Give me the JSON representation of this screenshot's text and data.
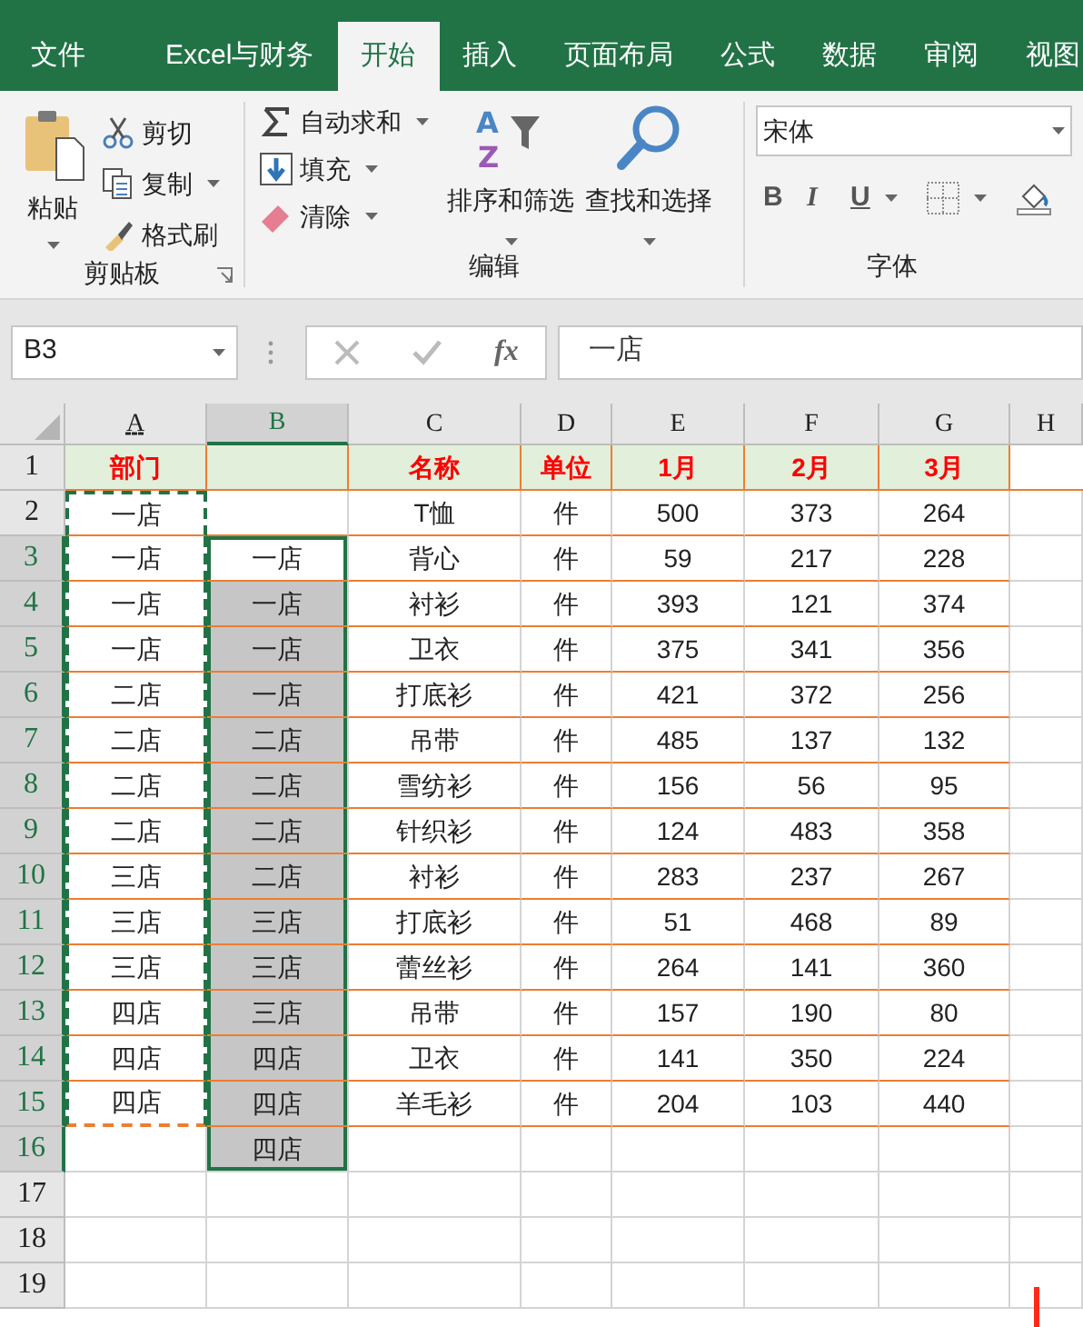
{
  "tabs": [
    {
      "label": "文件",
      "selected": false
    },
    {
      "label": "Excel与财务",
      "selected": false
    },
    {
      "label": "开始",
      "selected": true
    },
    {
      "label": "插入",
      "selected": false
    },
    {
      "label": "页面布局",
      "selected": false
    },
    {
      "label": "公式",
      "selected": false
    },
    {
      "label": "数据",
      "selected": false
    },
    {
      "label": "审阅",
      "selected": false
    },
    {
      "label": "视图",
      "selected": false
    }
  ],
  "ribbon": {
    "clipboard": {
      "label": "剪贴板",
      "paste": "粘贴",
      "cut": "剪切",
      "copy": "复制",
      "format_painter": "格式刷"
    },
    "editing": {
      "label": "编辑",
      "autosum": "自动求和",
      "fill": "填充",
      "clear": "清除",
      "sort_filter": "排序和筛选",
      "find_select": "查找和选择"
    },
    "font": {
      "label": "字体",
      "font_name": "宋体",
      "bold": "B",
      "italic": "I",
      "underline": "U"
    },
    "sort_icon_letters": {
      "top": "A",
      "bottom": "Z"
    }
  },
  "formula_bar": {
    "name_box": "B3",
    "function_label": "fx",
    "value": "一店"
  },
  "columns": [
    {
      "label": "A",
      "selected": false,
      "marquee": true
    },
    {
      "label": "B",
      "selected": true,
      "marquee": false
    },
    {
      "label": "C",
      "selected": false,
      "marquee": false
    },
    {
      "label": "D",
      "selected": false,
      "marquee": false
    },
    {
      "label": "E",
      "selected": false,
      "marquee": false
    },
    {
      "label": "F",
      "selected": false,
      "marquee": false
    },
    {
      "label": "G",
      "selected": false,
      "marquee": false
    },
    {
      "label": "H",
      "selected": false,
      "marquee": false
    }
  ],
  "rows": [
    {
      "number": "1",
      "kind": "header",
      "selected": false,
      "active": false,
      "marquee": false,
      "cells": [
        "部门",
        null,
        "名称",
        "单位",
        "1月",
        "2月",
        "3月",
        null
      ]
    },
    {
      "number": "2",
      "kind": "data",
      "selected": false,
      "active": false,
      "marquee": true,
      "cells": [
        "一店",
        null,
        "T恤",
        "件",
        "500",
        "373",
        "264",
        null
      ]
    },
    {
      "number": "3",
      "kind": "data",
      "selected": true,
      "active": true,
      "marquee": true,
      "cells": [
        "一店",
        "一店",
        "背心",
        "件",
        "59",
        "217",
        "228",
        null
      ]
    },
    {
      "number": "4",
      "kind": "data",
      "selected": true,
      "active": false,
      "marquee": true,
      "cells": [
        "一店",
        "一店",
        "衬衫",
        "件",
        "393",
        "121",
        "374",
        null
      ]
    },
    {
      "number": "5",
      "kind": "data",
      "selected": true,
      "active": false,
      "marquee": true,
      "cells": [
        "一店",
        "一店",
        "卫衣",
        "件",
        "375",
        "341",
        "356",
        null
      ]
    },
    {
      "number": "6",
      "kind": "data",
      "selected": true,
      "active": false,
      "marquee": true,
      "cells": [
        "二店",
        "一店",
        "打底衫",
        "件",
        "421",
        "372",
        "256",
        null
      ]
    },
    {
      "number": "7",
      "kind": "data",
      "selected": true,
      "active": false,
      "marquee": true,
      "cells": [
        "二店",
        "二店",
        "吊带",
        "件",
        "485",
        "137",
        "132",
        null
      ]
    },
    {
      "number": "8",
      "kind": "data",
      "selected": true,
      "active": false,
      "marquee": true,
      "cells": [
        "二店",
        "二店",
        "雪纺衫",
        "件",
        "156",
        "56",
        "95",
        null
      ]
    },
    {
      "number": "9",
      "kind": "data",
      "selected": true,
      "active": false,
      "marquee": true,
      "cells": [
        "二店",
        "二店",
        "针织衫",
        "件",
        "124",
        "483",
        "358",
        null
      ]
    },
    {
      "number": "10",
      "kind": "data",
      "selected": true,
      "active": false,
      "marquee": true,
      "cells": [
        "三店",
        "二店",
        "衬衫",
        "件",
        "283",
        "237",
        "267",
        null
      ]
    },
    {
      "number": "11",
      "kind": "data",
      "selected": true,
      "active": false,
      "marquee": true,
      "cells": [
        "三店",
        "三店",
        "打底衫",
        "件",
        "51",
        "468",
        "89",
        null
      ]
    },
    {
      "number": "12",
      "kind": "data",
      "selected": true,
      "active": false,
      "marquee": true,
      "cells": [
        "三店",
        "三店",
        "蕾丝衫",
        "件",
        "264",
        "141",
        "360",
        null
      ]
    },
    {
      "number": "13",
      "kind": "data",
      "selected": true,
      "active": false,
      "marquee": true,
      "cells": [
        "四店",
        "三店",
        "吊带",
        "件",
        "157",
        "190",
        "80",
        null
      ]
    },
    {
      "number": "14",
      "kind": "data",
      "selected": true,
      "active": false,
      "marquee": true,
      "cells": [
        "四店",
        "四店",
        "卫衣",
        "件",
        "141",
        "350",
        "224",
        null
      ]
    },
    {
      "number": "15",
      "kind": "data",
      "selected": true,
      "active": false,
      "marquee": true,
      "cells": [
        "四店",
        "四店",
        "羊毛衫",
        "件",
        "204",
        "103",
        "440",
        null
      ]
    },
    {
      "number": "16",
      "kind": "empty",
      "selected": true,
      "active": false,
      "marquee": false,
      "cells": [
        null,
        "四店",
        null,
        null,
        null,
        null,
        null,
        null
      ]
    },
    {
      "number": "17",
      "kind": "empty",
      "selected": false,
      "active": false,
      "marquee": false,
      "cells": [
        null,
        null,
        null,
        null,
        null,
        null,
        null,
        null
      ]
    },
    {
      "number": "18",
      "kind": "empty",
      "selected": false,
      "active": false,
      "marquee": false,
      "cells": [
        null,
        null,
        null,
        null,
        null,
        null,
        null,
        null
      ]
    },
    {
      "number": "19",
      "kind": "empty",
      "selected": false,
      "active": false,
      "marquee": false,
      "cells": [
        null,
        null,
        null,
        null,
        null,
        null,
        null,
        null
      ]
    }
  ]
}
